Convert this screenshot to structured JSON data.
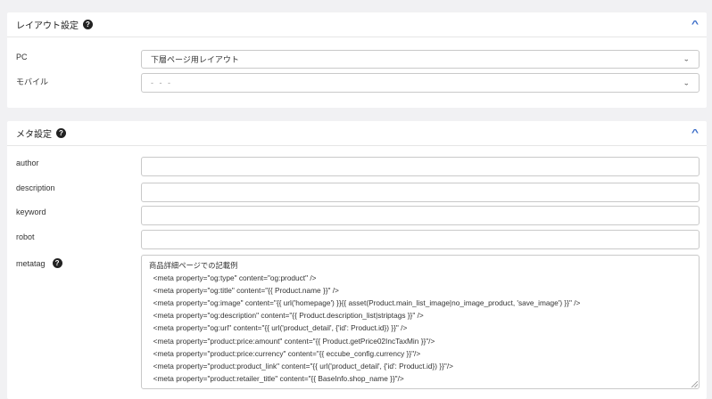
{
  "layout_section": {
    "title": "レイアウト設定",
    "fields": {
      "pc": {
        "label": "PC",
        "value": "下層ページ用レイアウト"
      },
      "mobile": {
        "label": "モバイル",
        "value": "- - -"
      }
    }
  },
  "meta_section": {
    "title": "メタ設定",
    "fields": {
      "author": {
        "label": "author",
        "value": ""
      },
      "description": {
        "label": "description",
        "value": ""
      },
      "keyword": {
        "label": "keyword",
        "value": ""
      },
      "robot": {
        "label": "robot",
        "value": ""
      },
      "metatag": {
        "label": "metatag",
        "lines": [
          "商品詳細ページでの記載例",
          "  <meta property=\"og:type\" content=\"og:product\" />",
          "  <meta property=\"og:title\" content=\"{{ Product.name }}\" />",
          "  <meta property=\"og:image\" content=\"{{ url('homepage') }}{{ asset(Product.main_list_image|no_image_product, 'save_image') }}\" />",
          "  <meta property=\"og:description\" content=\"{{ Product.description_list|striptags }}\" />",
          "  <meta property=\"og:url\" content=\"{{ url('product_detail', {'id': Product.id}) }}\" />",
          "  <meta property=\"product:price:amount\" content=\"{{ Product.getPrice02IncTaxMin }}\"/>",
          "  <meta property=\"product:price:currency\" content=\"{{ eccube_config.currency }}\"/>",
          "  <meta property=\"product:product_link\" content=\"{{ url('product_detail', {'id': Product.id}) }}\"/>",
          "  <meta property=\"product:retailer_title\" content=\"{{ BaseInfo.shop_name }}\"/>"
        ]
      }
    }
  },
  "icons": {
    "help": "question-circle-icon",
    "collapse": "chevron-up-icon",
    "select": "chevron-down-icon"
  },
  "colors": {
    "accent": "#3a6cc8",
    "background": "#f1f1f3",
    "border": "#c9c9c9"
  }
}
